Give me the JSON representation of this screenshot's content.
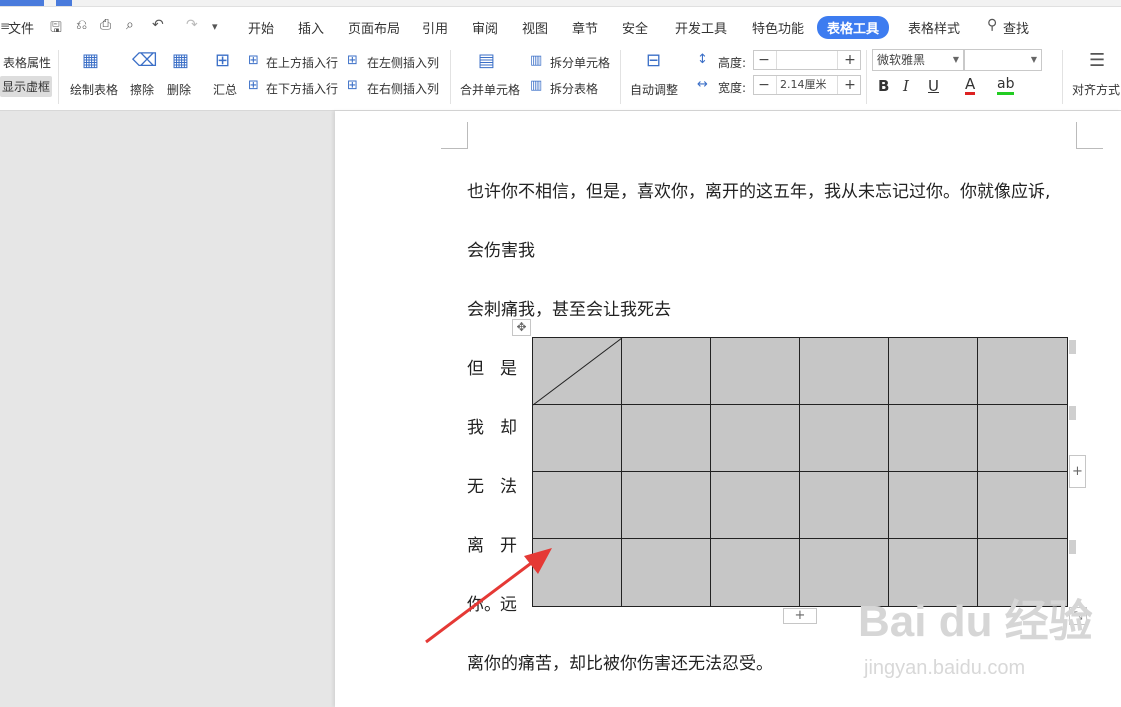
{
  "menubar": {
    "file_label": "文件",
    "tabs": [
      "开始",
      "插入",
      "页面布局",
      "引用",
      "审阅",
      "视图",
      "章节",
      "安全",
      "开发工具",
      "特色功能",
      "表格工具",
      "表格样式"
    ],
    "active_tab": "表格工具",
    "search_label": "查找"
  },
  "ribbon": {
    "table_props": "表格属性",
    "show_gridlines": "显示虚框",
    "draw_table": "绘制表格",
    "erase": "擦除",
    "delete": "删除",
    "summary": "汇总",
    "insert_above": "在上方插入行",
    "insert_below": "在下方插入行",
    "insert_left": "在左侧插入列",
    "insert_right": "在右侧插入列",
    "merge_cells": "合并单元格",
    "split_cells": "拆分单元格",
    "split_table": "拆分表格",
    "auto_adjust": "自动调整",
    "height_label": "高度:",
    "height_value": "",
    "width_label": "宽度:",
    "width_value": "2.14厘米",
    "font_name": "微软雅黑",
    "font_size": "",
    "bold": "B",
    "italic": "I",
    "underline": "U",
    "font_color": "A",
    "highlight": "ab",
    "align": "对齐方式"
  },
  "document": {
    "line1": "也许你不相信，但是，喜欢你，离开的这五年，我从未忘记过你。你就像应诉,",
    "line2": "会伤害我",
    "line3": "会刺痛我，甚至会让我死去",
    "left_column": [
      [
        "但",
        "是"
      ],
      [
        "我",
        "却"
      ],
      [
        "无",
        "法"
      ],
      [
        "离",
        "开"
      ],
      [
        "你。",
        "远"
      ]
    ],
    "last_line": "离你的痛苦，却比被你伤害还无法忍受。"
  },
  "table": {
    "rows": 4,
    "cols": 6
  },
  "watermark": {
    "main": "Bai du 经验",
    "sub": "jingyan.baidu.com"
  },
  "colors": {
    "accent": "#3d7cf0",
    "table_fill": "#c6c6c6",
    "arrow": "#e53935"
  }
}
